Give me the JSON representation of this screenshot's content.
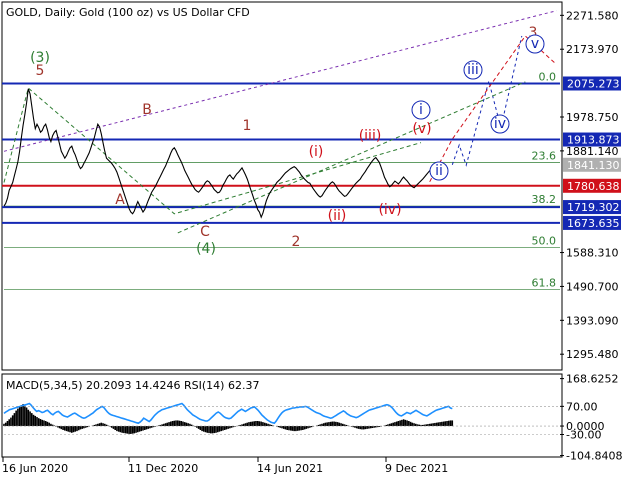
{
  "chart_data": {
    "type": "line",
    "title": "GOLD, Daily:  Gold (100 oz) vs US Dollar CFD",
    "ylim": [
      1250,
      2310
    ],
    "xlabel": "",
    "ylabel": "",
    "grid": false,
    "y_ticks": [
      "2271.580",
      "2173.970",
      "1978.750",
      "1881.140",
      "1588.310",
      "1490.700",
      "1393.090",
      "1295.480"
    ],
    "x_ticks": [
      "16 Jun 2020",
      "11 Dec 2020",
      "14 Jun 2021",
      "9 Dec 2021"
    ],
    "levels": [
      {
        "name": "level-2075",
        "price": 2075.273,
        "label": "2075.273",
        "color": "#1428b4"
      },
      {
        "name": "level-1913",
        "price": 1913.873,
        "label": "1913.873",
        "color": "#1428b4"
      },
      {
        "name": "level-1780",
        "price": 1780.638,
        "label": "1780.638",
        "color": "#d0101a"
      },
      {
        "name": "level-1719",
        "price": 1719.302,
        "label": "1719.302",
        "color": "#1428b4"
      },
      {
        "name": "level-1673",
        "price": 1673.635,
        "label": "1673.635",
        "color": "#1428b4"
      }
    ],
    "current_price": {
      "price": 1841.13,
      "label": "1841.130",
      "color": "#b0b0b0"
    },
    "fib_levels": [
      {
        "price": 2075.273,
        "label": "0.0"
      },
      {
        "price": 1848,
        "label": "23.6"
      },
      {
        "price": 1722,
        "label": "38.2"
      },
      {
        "price": 1603,
        "label": "50.0"
      },
      {
        "price": 1482,
        "label": "61.8"
      }
    ],
    "wave_labels": [
      {
        "text": "(3)",
        "color": "#2e7d32",
        "circle": false
      },
      {
        "text": "5",
        "color": "#a0352c",
        "circle": false
      },
      {
        "text": "A",
        "color": "#a0352c",
        "circle": false
      },
      {
        "text": "B",
        "color": "#a0352c",
        "circle": false
      },
      {
        "text": "C",
        "color": "#a0352c",
        "circle": false
      },
      {
        "text": "(4)",
        "color": "#2e7d32",
        "circle": false
      },
      {
        "text": "1",
        "color": "#a0352c",
        "circle": false
      },
      {
        "text": "2",
        "color": "#a0352c",
        "circle": false
      },
      {
        "text": "3",
        "color": "#a0352c",
        "circle": false
      },
      {
        "text": "(i)",
        "color": "#d0101a",
        "circle": false
      },
      {
        "text": "(ii)",
        "color": "#d0101a",
        "circle": false
      },
      {
        "text": "(iii)",
        "color": "#d0101a",
        "circle": false
      },
      {
        "text": "(iv)",
        "color": "#d0101a",
        "circle": false
      },
      {
        "text": "(v)",
        "color": "#d0101a",
        "circle": false
      },
      {
        "text": "i",
        "color": "#1428b4",
        "circle": true
      },
      {
        "text": "ii",
        "color": "#1428b4",
        "circle": true
      },
      {
        "text": "iii",
        "color": "#1428b4",
        "circle": true
      },
      {
        "text": "iv",
        "color": "#1428b4",
        "circle": true
      },
      {
        "text": "v",
        "color": "#1428b4",
        "circle": true
      }
    ],
    "price_series": [
      1722,
      1730,
      1745,
      1768,
      1778,
      1790,
      1810,
      1830,
      1850,
      1880,
      1920,
      1955,
      1985,
      2020,
      2060,
      2045,
      2010,
      1975,
      1945,
      1958,
      1948,
      1935,
      1940,
      1952,
      1958,
      1942,
      1920,
      1908,
      1925,
      1935,
      1940,
      1920,
      1900,
      1880,
      1870,
      1860,
      1868,
      1880,
      1890,
      1895,
      1880,
      1870,
      1855,
      1840,
      1830,
      1835,
      1845,
      1855,
      1865,
      1875,
      1890,
      1905,
      1920,
      1940,
      1958,
      1950,
      1930,
      1905,
      1880,
      1860,
      1855,
      1850,
      1845,
      1838,
      1830,
      1820,
      1805,
      1790,
      1775,
      1760,
      1745,
      1730,
      1715,
      1705,
      1700,
      1708,
      1722,
      1735,
      1725,
      1715,
      1705,
      1712,
      1725,
      1738,
      1750,
      1762,
      1770,
      1778,
      1788,
      1798,
      1808,
      1818,
      1828,
      1838,
      1850,
      1862,
      1875,
      1885,
      1890,
      1882,
      1870,
      1860,
      1850,
      1838,
      1825,
      1815,
      1805,
      1795,
      1785,
      1778,
      1770,
      1765,
      1762,
      1768,
      1775,
      1782,
      1790,
      1795,
      1792,
      1785,
      1778,
      1770,
      1765,
      1760,
      1762,
      1770,
      1782,
      1790,
      1800,
      1808,
      1812,
      1805,
      1800,
      1808,
      1815,
      1820,
      1826,
      1832,
      1822,
      1812,
      1800,
      1785,
      1770,
      1755,
      1740,
      1728,
      1712,
      1705,
      1690,
      1702,
      1720,
      1738,
      1750,
      1760,
      1768,
      1775,
      1782,
      1790,
      1795,
      1800,
      1806,
      1812,
      1818,
      1822,
      1826,
      1830,
      1833,
      1836,
      1832,
      1826,
      1820,
      1812,
      1806,
      1800,
      1795,
      1790,
      1788,
      1780,
      1772,
      1765,
      1758,
      1752,
      1748,
      1752,
      1760,
      1768,
      1775,
      1782,
      1788,
      1792,
      1788,
      1780,
      1772,
      1765,
      1760,
      1755,
      1750,
      1752,
      1758,
      1765,
      1772,
      1778,
      1785,
      1790,
      1795,
      1800,
      1808,
      1815,
      1822,
      1830,
      1838,
      1845,
      1852,
      1858,
      1862,
      1855,
      1848,
      1835,
      1820,
      1805,
      1795,
      1785,
      1778,
      1782,
      1788,
      1794,
      1790,
      1786,
      1792,
      1800,
      1806,
      1800,
      1795,
      1788,
      1782,
      1778,
      1775,
      1780,
      1785,
      1790,
      1795,
      1800,
      1806,
      1812,
      1818,
      1824,
      1830,
      1836,
      1841
    ],
    "projection_lines": [
      {
        "color": "#1428b4",
        "dash": "3,3",
        "points": [
          {
            "i": 258,
            "y": 1841
          },
          {
            "i": 262,
            "y": 1898
          },
          {
            "i": 266,
            "y": 1840
          },
          {
            "i": 279,
            "y": 2082
          },
          {
            "i": 286,
            "y": 1948
          },
          {
            "i": 298,
            "y": 2212
          }
        ]
      },
      {
        "color": "#d0101a",
        "dash": "4,3",
        "points": [
          {
            "i": 245,
            "y": 1792
          },
          {
            "i": 258,
            "y": 1915
          },
          {
            "i": 300,
            "y": 2212
          },
          {
            "i": 318,
            "y": 2130
          }
        ]
      },
      {
        "color": "#7a2fb0",
        "dash": "3,3",
        "points": [
          {
            "i": 0,
            "y": 1880
          },
          {
            "i": 318,
            "y": 2285
          }
        ]
      },
      {
        "color": "#2e7d32",
        "dash": "4,3",
        "points": [
          {
            "i": 100,
            "y": 1645
          },
          {
            "i": 300,
            "y": 2080
          }
        ]
      },
      {
        "color": "#2e7d32",
        "dash": "4,3",
        "points": [
          {
            "i": 0,
            "y": 1790
          },
          {
            "i": 14,
            "y": 2062
          },
          {
            "i": 98,
            "y": 1700
          },
          {
            "i": 240,
            "y": 1905
          }
        ]
      }
    ],
    "indicator": {
      "label": "MACD(5,34,5) 20.2093 14.4246 RSI(14) 62.37",
      "ylim": [
        -110,
        185
      ],
      "y_ticks": [
        "168.6252",
        "70.00",
        "0.0000",
        "-30.00",
        "-104.8408"
      ],
      "macd_values": [
        8,
        12,
        18,
        24,
        30,
        38,
        46,
        55,
        62,
        68,
        74,
        78,
        72,
        66,
        58,
        52,
        46,
        40,
        36,
        32,
        28,
        25,
        22,
        20,
        18,
        15,
        12,
        8,
        5,
        2,
        -2,
        -5,
        -8,
        -11,
        -14,
        -16,
        -18,
        -20,
        -22,
        -24,
        -22,
        -20,
        -18,
        -15,
        -12,
        -10,
        -8,
        -6,
        -4,
        -2,
        0,
        2,
        4,
        6,
        8,
        10,
        12,
        10,
        8,
        5,
        2,
        -2,
        -6,
        -10,
        -14,
        -18,
        -20,
        -22,
        -24,
        -25,
        -26,
        -27,
        -28,
        -28,
        -27,
        -26,
        -24,
        -22,
        -20,
        -18,
        -16,
        -14,
        -12,
        -10,
        -8,
        -6,
        -4,
        -2,
        0,
        2,
        4,
        6,
        8,
        10,
        12,
        14,
        16,
        18,
        19,
        20,
        20,
        19,
        18,
        16,
        14,
        12,
        10,
        8,
        5,
        2,
        -2,
        -6,
        -10,
        -14,
        -18,
        -20,
        -22,
        -24,
        -25,
        -26,
        -26,
        -25,
        -24,
        -22,
        -20,
        -18,
        -16,
        -14,
        -12,
        -10,
        -8,
        -6,
        -4,
        -2,
        0,
        2,
        4,
        6,
        8,
        10,
        12,
        14,
        15,
        16,
        17,
        18,
        18,
        17,
        16,
        14,
        12,
        10,
        8,
        6,
        4,
        2,
        0,
        -2,
        -4,
        -6,
        -8,
        -10,
        -12,
        -14,
        -15,
        -16,
        -17,
        -18,
        -18,
        -17,
        -16,
        -15,
        -14,
        -12,
        -10,
        -8,
        -6,
        -4,
        -2,
        0,
        2,
        4,
        6,
        8,
        10,
        12,
        13,
        14,
        15,
        16,
        16,
        15,
        14,
        12,
        10,
        8,
        6,
        4,
        2,
        0,
        -2,
        -4,
        -6,
        -8,
        -10,
        -11,
        -12,
        -12,
        -11,
        -10,
        -9,
        -8,
        -7,
        -6,
        -5,
        -4,
        -3,
        -2,
        0,
        2,
        4,
        6,
        8,
        10,
        12,
        14,
        16,
        18,
        20,
        22,
        24,
        22,
        20,
        18,
        15,
        12,
        10,
        8,
        6,
        5,
        4,
        4,
        5,
        6,
        7,
        8,
        9,
        10,
        11,
        12,
        13,
        14,
        15,
        16,
        17,
        18,
        19,
        20,
        20
      ],
      "rsi_values": [
        45,
        50,
        54,
        58,
        60,
        62,
        64,
        66,
        68,
        70,
        72,
        74,
        76,
        78,
        80,
        74,
        66,
        58,
        52,
        55,
        52,
        48,
        50,
        54,
        56,
        50,
        44,
        40,
        46,
        50,
        52,
        46,
        40,
        36,
        34,
        32,
        36,
        40,
        44,
        46,
        42,
        38,
        34,
        30,
        28,
        30,
        34,
        38,
        42,
        46,
        52,
        58,
        62,
        66,
        70,
        66,
        58,
        50,
        44,
        40,
        38,
        36,
        34,
        32,
        30,
        28,
        26,
        24,
        22,
        20,
        18,
        16,
        14,
        12,
        10,
        14,
        20,
        28,
        24,
        20,
        16,
        22,
        30,
        38,
        44,
        50,
        54,
        58,
        60,
        62,
        64,
        66,
        68,
        70,
        72,
        74,
        76,
        78,
        80,
        74,
        66,
        58,
        52,
        46,
        40,
        36,
        32,
        28,
        24,
        22,
        20,
        18,
        18,
        22,
        28,
        34,
        40,
        46,
        50,
        46,
        40,
        34,
        30,
        28,
        26,
        28,
        34,
        40,
        46,
        52,
        56,
        60,
        56,
        52,
        56,
        60,
        64,
        66,
        68,
        62,
        56,
        48,
        40,
        34,
        28,
        22,
        18,
        14,
        12,
        10,
        18,
        28,
        38,
        46,
        52,
        56,
        58,
        60,
        62,
        64,
        64,
        66,
        66,
        68,
        68,
        68,
        70,
        68,
        64,
        60,
        56,
        52,
        48,
        46,
        44,
        40,
        36,
        34,
        32,
        30,
        28,
        30,
        34,
        38,
        42,
        46,
        50,
        54,
        50,
        44,
        40,
        36,
        34,
        32,
        30,
        32,
        36,
        40,
        44,
        48,
        52,
        56,
        58,
        60,
        62,
        64,
        66,
        68,
        70,
        72,
        74,
        76,
        74,
        70,
        64,
        56,
        48,
        42,
        38,
        36,
        40,
        44,
        48,
        46,
        44,
        48,
        52,
        56,
        52,
        48,
        44,
        40,
        38,
        36,
        40,
        44,
        48,
        52,
        56,
        58,
        60,
        62,
        64,
        66,
        68,
        70,
        64,
        62
      ]
    }
  },
  "colors": {
    "background": "#ffffff",
    "price_line": "#000000",
    "blue_level": "#1428b4",
    "red_level": "#d0101a",
    "fib_green": "#2e7d32",
    "rsi_line": "#1e90ff",
    "macd_hist": "#000000"
  }
}
